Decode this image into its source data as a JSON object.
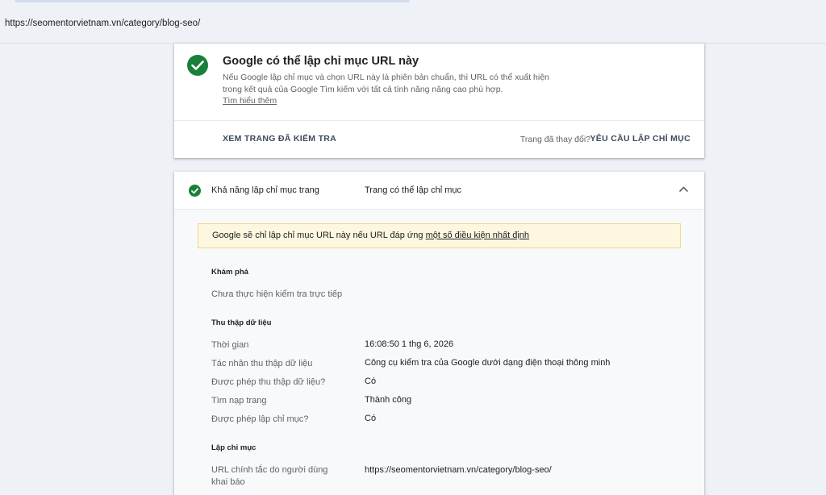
{
  "top": {
    "url": "https://seomentorvietnam.vn/category/blog-seo/"
  },
  "status_card": {
    "title": "Google có thể lập chỉ mục URL này",
    "description": "Nếu Google lập chỉ mục và chọn URL này là phiên bản chuẩn, thì URL có thể xuất hiện trong kết quả của Google Tìm kiếm với tất cả tính năng nâng cao phù hợp.",
    "learn_more": "Tìm hiểu thêm",
    "view_tested_page": "XEM TRANG ĐÃ KIỂM TRA",
    "page_changed": "Trang đã thay đổi?",
    "request_indexing": "YÊU CẦU LẬP CHỈ MỤC",
    "accent": "#188038"
  },
  "indexability": {
    "label": "Khả năng lập chỉ mục trang",
    "value": "Trang có thể lập chỉ mục",
    "notice_text": "Google sẽ chỉ lập chỉ mục URL này nếu URL đáp ứng ",
    "notice_link": "một số điều kiện nhất định",
    "discovery": {
      "title": "Khám phá",
      "text": "Chưa thực hiện kiểm tra trực tiếp"
    },
    "crawl": {
      "title": "Thu thập dữ liệu",
      "rows": [
        {
          "label": "Thời gian",
          "value": "16:08:50 1 thg 6, 2026"
        },
        {
          "label": "Tác nhân thu thập dữ liệu",
          "value": "Công cụ kiểm tra của Google dưới dạng điện thoại thông minh"
        },
        {
          "label": "Được phép thu thập dữ liệu?",
          "value": "Có"
        },
        {
          "label": "Tìm nạp trang",
          "value": "Thành công"
        },
        {
          "label": "Được phép lập chỉ mục?",
          "value": "Có"
        }
      ]
    },
    "indexing": {
      "title": "Lập chỉ mục",
      "rows": [
        {
          "label": "URL chính tắc do người dùng khai báo",
          "value": "https://seomentorvietnam.vn/category/blog-seo/"
        }
      ]
    }
  }
}
